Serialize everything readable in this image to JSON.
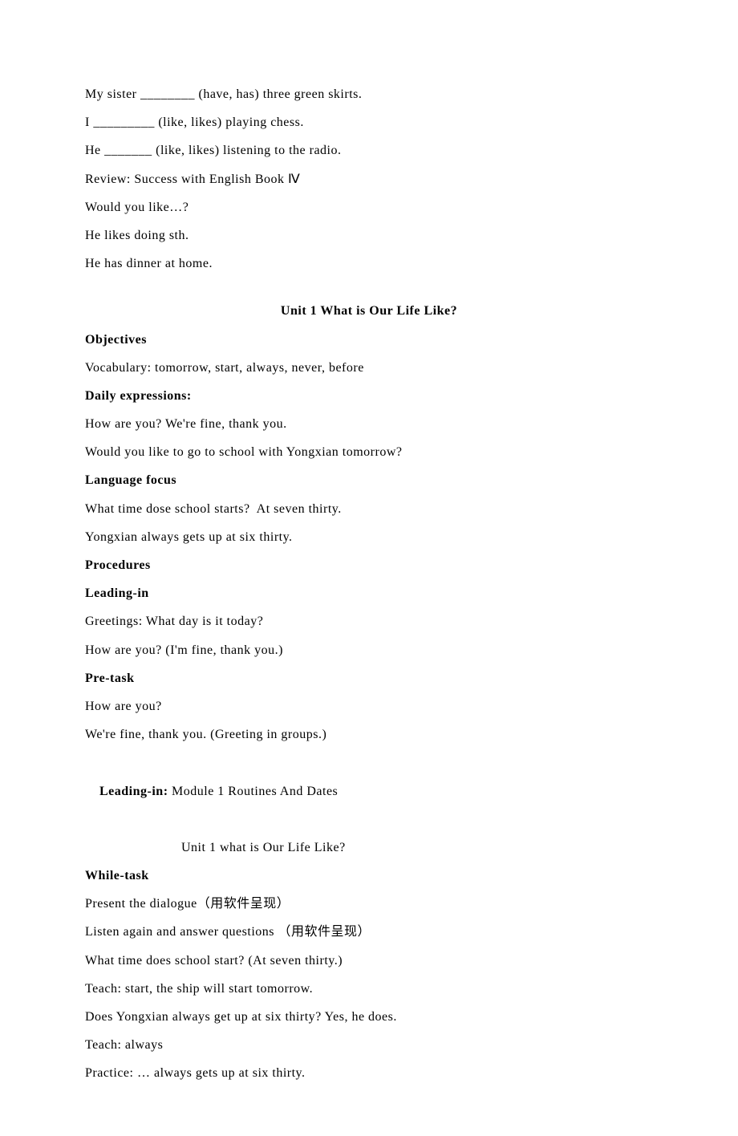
{
  "top": {
    "l1": "My sister ________ (have, has) three green skirts.",
    "l2": "I _________ (like, likes) playing chess.",
    "l3": "He _______ (like, likes) listening to the radio.",
    "l4": "Review: Success with English Book Ⅳ",
    "l5": "Would you like…?",
    "l6": "He likes doing sth.",
    "l7": "He has dinner at home."
  },
  "unit": {
    "title": "Unit 1 What is Our Life Like?",
    "obj_h": "Objectives",
    "obj_l1": "Vocabulary: tomorrow, start, always, never, before",
    "daily_h": "Daily expressions:",
    "daily_l1": "How are you? We're fine, thank you.",
    "daily_l2": "Would you like to go to school with Yongxian tomorrow?",
    "lang_h": "Language focus",
    "lang_l1": "What time dose school starts?  At seven thirty.",
    "lang_l2": "Yongxian always gets up at six thirty.",
    "proc_h": "Procedures",
    "lead_h": "Leading-in",
    "lead_l1": "Greetings: What day is it today?",
    "lead_l2": "How are you? (I'm fine, thank you.)",
    "pre_h": "Pre-task",
    "pre_l1": "How are you?",
    "pre_l2": "We're fine, thank you. (Greeting in groups.)",
    "lead2_h": "Leading-in:",
    "lead2_l1": " Module 1 Routines And Dates",
    "lead2_l2": "Unit 1 what is Our Life Like?",
    "while_h": "While-task",
    "while_l1": "Present the dialogue（用软件呈现）",
    "while_l2": "Listen again and answer questions （用软件呈现）",
    "while_l3": "What time does school start? (At seven thirty.)",
    "while_l4": "Teach: start, the ship will start tomorrow.",
    "while_l5": "Does Yongxian always get up at six thirty? Yes, he does.",
    "while_l6": "Teach: always",
    "while_l7": "Practice: … always gets up at six thirty."
  }
}
